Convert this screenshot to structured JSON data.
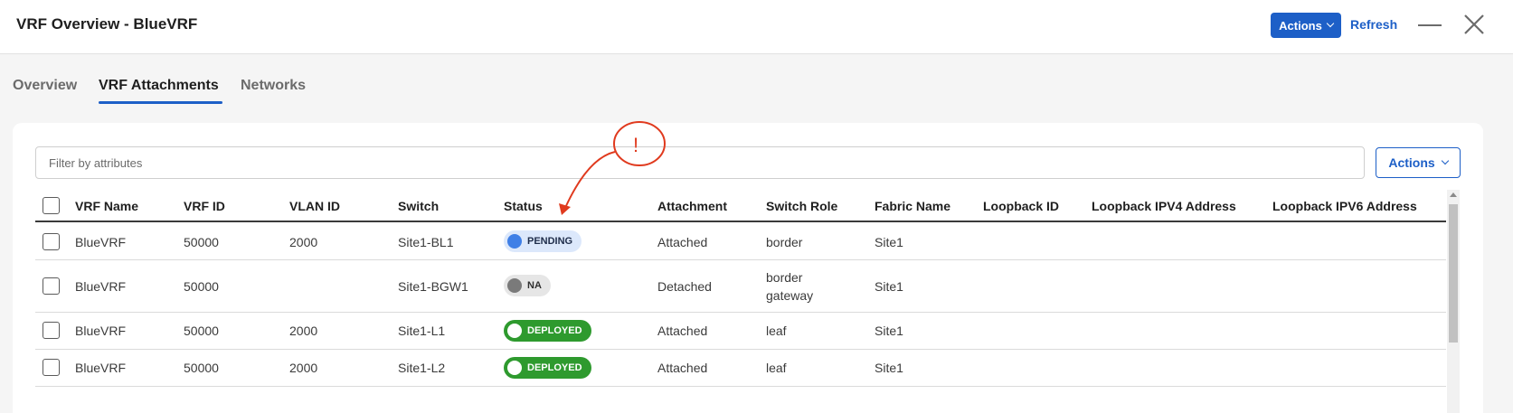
{
  "header": {
    "title": "VRF Overview - BlueVRF",
    "actions_label": "Actions",
    "refresh_label": "Refresh"
  },
  "tabs": [
    {
      "label": "Overview",
      "active": false
    },
    {
      "label": "VRF Attachments",
      "active": true
    },
    {
      "label": "Networks",
      "active": false
    }
  ],
  "filter": {
    "placeholder": "Filter by attributes",
    "value": ""
  },
  "table_actions_label": "Actions",
  "table": {
    "columns": [
      "VRF Name",
      "VRF ID",
      "VLAN ID",
      "Switch",
      "Status",
      "Attachment",
      "Switch Role",
      "Fabric Name",
      "Loopback ID",
      "Loopback IPV4 Address",
      "Loopback IPV6 Address"
    ],
    "rows": [
      {
        "vrf_name": "BlueVRF",
        "vrf_id": "50000",
        "vlan_id": "2000",
        "switch": "Site1-BL1",
        "status": "PENDING",
        "attachment": "Attached",
        "switch_role": "border",
        "switch_role_line2": "",
        "fabric_name": "Site1"
      },
      {
        "vrf_name": "BlueVRF",
        "vrf_id": "50000",
        "vlan_id": "",
        "switch": "Site1-BGW1",
        "status": "NA",
        "attachment": "Detached",
        "switch_role": "border",
        "switch_role_line2": "gateway",
        "fabric_name": "Site1"
      },
      {
        "vrf_name": "BlueVRF",
        "vrf_id": "50000",
        "vlan_id": "2000",
        "switch": "Site1-L1",
        "status": "DEPLOYED",
        "attachment": "Attached",
        "switch_role": "leaf",
        "switch_role_line2": "",
        "fabric_name": "Site1"
      },
      {
        "vrf_name": "BlueVRF",
        "vrf_id": "50000",
        "vlan_id": "2000",
        "switch": "Site1-L2",
        "status": "DEPLOYED",
        "attachment": "Attached",
        "switch_role": "leaf",
        "switch_role_line2": "",
        "fabric_name": "Site1"
      }
    ]
  },
  "annotation": {
    "mark": "!",
    "color": "#e03a1e"
  },
  "colors": {
    "accent": "#1d5fc7",
    "pending": "#3f7fe6",
    "deployed": "#2e9a2e",
    "na": "#7a7a7a"
  }
}
